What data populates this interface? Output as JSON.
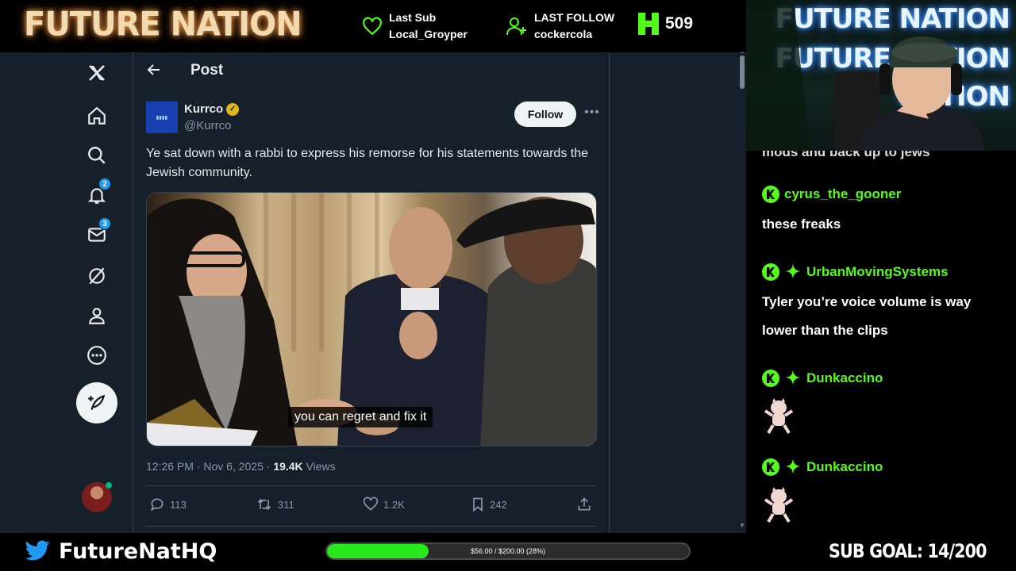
{
  "overlay": {
    "logo": "FUTURE NATION",
    "last_sub_label": "Last Sub",
    "last_sub_name": "Local_Groyper",
    "last_follow_label": "LAST FOLLOW",
    "last_follow_name": "cockercola",
    "kick_count": "509",
    "twitter_handle": "FutureNatHQ",
    "goal_text": "$56.00 / $200.00 (28%)",
    "goal_progress": 0.28,
    "sub_goal": "SUB GOAL: 14/200",
    "cam_neon": [
      "FUTURE NATION",
      "FUTURE NATION",
      "NATION"
    ]
  },
  "nav": {
    "notifications_badge": "2",
    "messages_badge": "3",
    "items": [
      "x-logo",
      "home-icon",
      "search-icon",
      "bell-icon",
      "mail-icon",
      "grok-icon",
      "profile-icon",
      "more-icon"
    ]
  },
  "post": {
    "header_title": "Post",
    "author_name": "Kurrco",
    "author_handle": "@Kurrco",
    "follow_label": "Follow",
    "text": "Ye sat down with a rabbi to express his remorse for his statements towards the Jewish community.",
    "media_caption": "you can regret and fix it",
    "time": "12:26 PM · Nov 6, 2025 · ",
    "views": "19.4K",
    "views_label": " Views",
    "replies": "113",
    "reposts": "311",
    "likes": "1.2K",
    "bookmarks": "242"
  },
  "chat": {
    "partial_line": "mods and back up to jews",
    "messages": [
      {
        "user": "cyrus_the_gooner",
        "text": "these freaks",
        "badges": [
          "kick"
        ]
      },
      {
        "user": "UrbanMovingSystems",
        "text": "Tyler you’re voice volume is way lower than the clips",
        "badges": [
          "kick",
          "star"
        ]
      },
      {
        "user": "Dunkaccino",
        "text": "",
        "badges": [
          "kick",
          "star"
        ]
      },
      {
        "user": "Dunkaccino",
        "text": "",
        "badges": [
          "kick",
          "star"
        ]
      }
    ]
  },
  "colors": {
    "x_bg": "#15202b",
    "kick_green": "#53fc18",
    "goal_green": "#26e81a",
    "verified_gold": "#e2b719"
  }
}
